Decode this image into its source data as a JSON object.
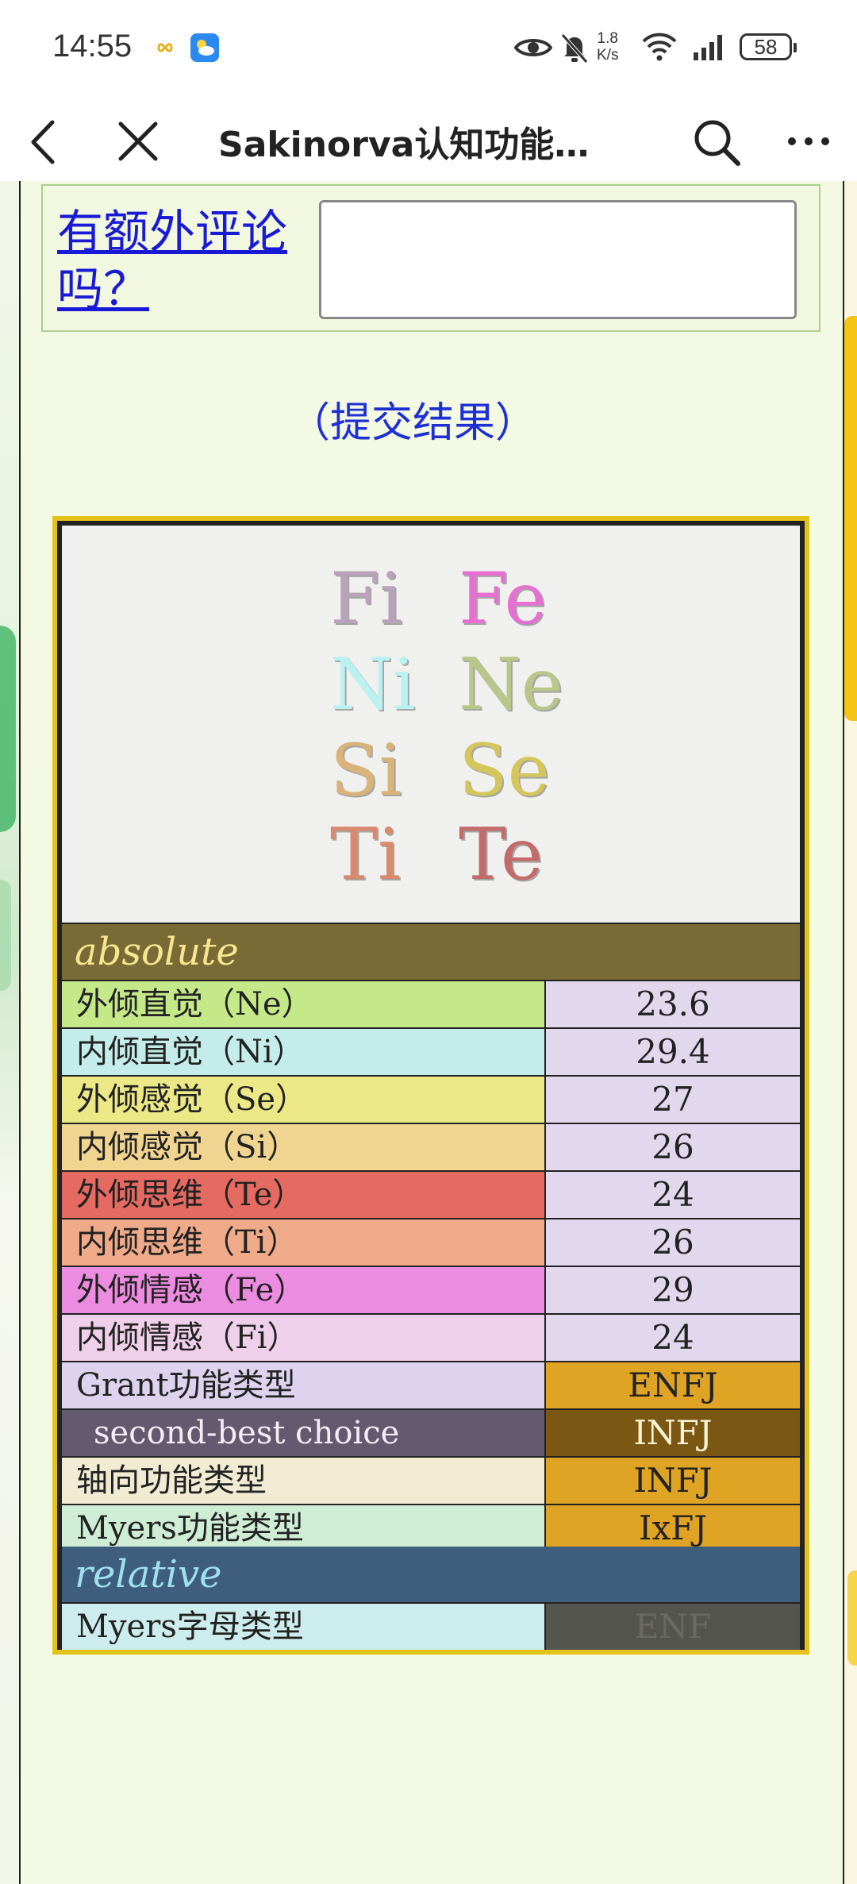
{
  "status_bar": {
    "time": "14:55",
    "net_speed_value": "1.8",
    "net_speed_unit": "K/s",
    "battery": "58",
    "icons": [
      "infinity-icon",
      "weather-icon",
      "eye-icon",
      "bell-muted-icon",
      "wifi-icon",
      "signal-icon",
      "battery-icon"
    ]
  },
  "nav": {
    "title": "Sakinorva认知功能…",
    "back_icon": "chevron-left-icon",
    "close_icon": "close-icon",
    "search_icon": "search-icon",
    "more_icon": "more-icon"
  },
  "form": {
    "comment_label": "有额外评论吗？",
    "comment_value": "",
    "submit_result_label": "（提交结果）"
  },
  "functions_panel": {
    "left": [
      "Fi",
      "Ni",
      "Si",
      "Ti"
    ],
    "right": [
      "Fe",
      "Ne",
      "Se",
      "Te"
    ],
    "colors": {
      "Fi": "#b9a2ba",
      "Fe": "#e86fd2",
      "Ni": "#b9f2f0",
      "Ne": "#b9c68a",
      "Si": "#d9b37a",
      "Se": "#d4c65a",
      "Ti": "#d98a6e",
      "Te": "#c26b6b"
    }
  },
  "results": {
    "absolute_label": "absolute",
    "rows": [
      {
        "label": "外倾直觉（Ne）",
        "value": "23.6",
        "label_bg": "#c5e888",
        "value_bg": "#e2d8ee"
      },
      {
        "label": "内倾直觉（Ni）",
        "value": "29.4",
        "label_bg": "#c4ecea",
        "value_bg": "#e2d8ee"
      },
      {
        "label": "外倾感觉（Se）",
        "value": "27",
        "label_bg": "#ece888",
        "value_bg": "#e2d8ee"
      },
      {
        "label": "内倾感觉（Si）",
        "value": "26",
        "label_bg": "#f0d591",
        "value_bg": "#e2d8ee"
      },
      {
        "label": "外倾思维（Te）",
        "value": "24",
        "label_bg": "#e56a62",
        "value_bg": "#e2d8ee"
      },
      {
        "label": "内倾思维（Ti）",
        "value": "26",
        "label_bg": "#efaa8a",
        "value_bg": "#e2d8ee"
      },
      {
        "label": "外倾情感（Fe）",
        "value": "29",
        "label_bg": "#ec8ce0",
        "value_bg": "#e2d8ee"
      },
      {
        "label": "内倾情感（Fi）",
        "value": "24",
        "label_bg": "#efd0ea",
        "value_bg": "#e2d8ee"
      },
      {
        "label": "Grant功能类型",
        "value": "ENFJ",
        "label_bg": "#ddd3ee",
        "value_bg": "#e0a425"
      },
      {
        "label": "second-best choice",
        "value": "INFJ",
        "label_bg": "#645a70",
        "value_bg": "#7a5814"
      },
      {
        "label": "轴向功能类型",
        "value": "INFJ",
        "label_bg": "#f2ebd4",
        "value_bg": "#e0a425"
      },
      {
        "label": "Myers功能类型",
        "value": "IxFJ",
        "label_bg": "#cfedd5",
        "value_bg": "#e0a425"
      }
    ],
    "relative_label": "relative",
    "relative_rows": [
      {
        "label": "Myers字母类型",
        "value": "ENF",
        "label_bg": "#cdecee",
        "value_bg": "#555550"
      }
    ]
  }
}
